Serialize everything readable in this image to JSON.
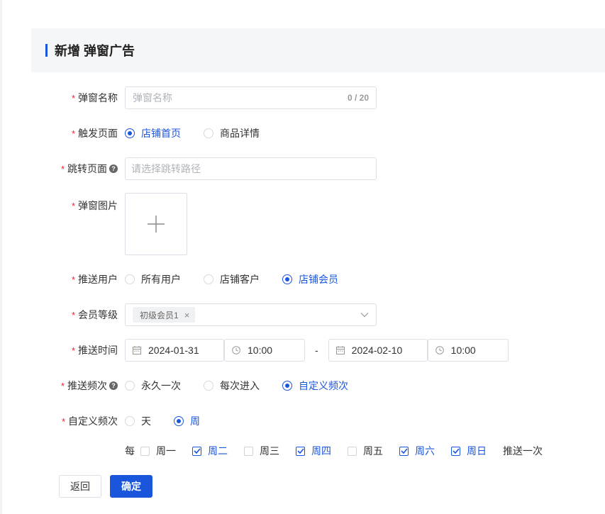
{
  "header": {
    "title": "新增 弹窗广告"
  },
  "form": {
    "popup_name": {
      "label": "弹窗名称",
      "placeholder": "弹窗名称",
      "count": "0 / 20"
    },
    "trigger_page": {
      "label": "触发页面",
      "options": [
        {
          "label": "店铺首页",
          "selected": true
        },
        {
          "label": "商品详情",
          "selected": false
        }
      ]
    },
    "jump_page": {
      "label": "跳转页面",
      "placeholder": "请选择跳转路径",
      "help": "?"
    },
    "popup_image": {
      "label": "弹窗图片"
    },
    "push_users": {
      "label": "推送用户",
      "options": [
        {
          "label": "所有用户",
          "selected": false
        },
        {
          "label": "店铺客户",
          "selected": false
        },
        {
          "label": "店铺会员",
          "selected": true
        }
      ]
    },
    "member_level": {
      "label": "会员等级",
      "tag": "初级会员1",
      "tag_close": "×"
    },
    "push_time": {
      "label": "推送时间",
      "start_date": "2024-01-31",
      "start_time": "10:00",
      "separator": "-",
      "end_date": "2024-02-10",
      "end_time": "10:00"
    },
    "push_frequency": {
      "label": "推送频次",
      "help": "?",
      "options": [
        {
          "label": "永久一次",
          "selected": false
        },
        {
          "label": "每次进入",
          "selected": false
        },
        {
          "label": "自定义频次",
          "selected": true
        }
      ]
    },
    "custom_frequency": {
      "label": "自定义频次",
      "options": [
        {
          "label": "天",
          "selected": false
        },
        {
          "label": "周",
          "selected": true
        }
      ]
    },
    "weekdays": {
      "prefix": "每",
      "days": [
        {
          "label": "周一",
          "checked": false
        },
        {
          "label": "周二",
          "checked": true
        },
        {
          "label": "周三",
          "checked": false
        },
        {
          "label": "周四",
          "checked": true
        },
        {
          "label": "周五",
          "checked": false
        },
        {
          "label": "周六",
          "checked": true
        },
        {
          "label": "周日",
          "checked": true
        }
      ],
      "suffix": "推送一次"
    }
  },
  "buttons": {
    "back": "返回",
    "confirm": "确定"
  },
  "colors": {
    "primary": "#1a56db",
    "required": "#f5222d"
  }
}
